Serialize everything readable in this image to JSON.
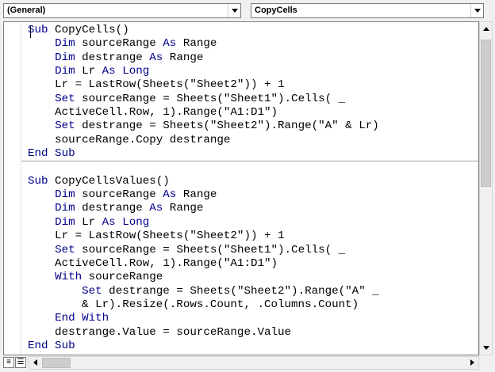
{
  "object_combo": {
    "value": "(General)"
  },
  "procedure_combo": {
    "value": "CopyCells"
  },
  "code": {
    "lines": [
      [
        [
          "kw",
          "Sub"
        ],
        [
          "t",
          " CopyCells()"
        ]
      ],
      [
        [
          "t",
          "    "
        ],
        [
          "kw",
          "Dim"
        ],
        [
          "t",
          " sourceRange "
        ],
        [
          "kw",
          "As"
        ],
        [
          "t",
          " Range"
        ]
      ],
      [
        [
          "t",
          "    "
        ],
        [
          "kw",
          "Dim"
        ],
        [
          "t",
          " destrange "
        ],
        [
          "kw",
          "As"
        ],
        [
          "t",
          " Range"
        ]
      ],
      [
        [
          "t",
          "    "
        ],
        [
          "kw",
          "Dim"
        ],
        [
          "t",
          " Lr "
        ],
        [
          "kw",
          "As Long"
        ]
      ],
      [
        [
          "t",
          "    Lr = LastRow(Sheets(\"Sheet2\")) + 1"
        ]
      ],
      [
        [
          "t",
          "    "
        ],
        [
          "kw",
          "Set"
        ],
        [
          "t",
          " sourceRange = Sheets(\"Sheet1\").Cells( _"
        ]
      ],
      [
        [
          "t",
          "    ActiveCell.Row, 1).Range(\"A1:D1\")"
        ]
      ],
      [
        [
          "t",
          "    "
        ],
        [
          "kw",
          "Set"
        ],
        [
          "t",
          " destrange = Sheets(\"Sheet2\").Range(\"A\" & Lr)"
        ]
      ],
      [
        [
          "t",
          "    sourceRange.Copy destrange"
        ]
      ],
      [
        [
          "kw",
          "End Sub"
        ]
      ],
      [
        [
          "t",
          ""
        ]
      ],
      [
        [
          "kw",
          "Sub"
        ],
        [
          "t",
          " CopyCellsValues()"
        ]
      ],
      [
        [
          "t",
          "    "
        ],
        [
          "kw",
          "Dim"
        ],
        [
          "t",
          " sourceRange "
        ],
        [
          "kw",
          "As"
        ],
        [
          "t",
          " Range"
        ]
      ],
      [
        [
          "t",
          "    "
        ],
        [
          "kw",
          "Dim"
        ],
        [
          "t",
          " destrange "
        ],
        [
          "kw",
          "As"
        ],
        [
          "t",
          " Range"
        ]
      ],
      [
        [
          "t",
          "    "
        ],
        [
          "kw",
          "Dim"
        ],
        [
          "t",
          " Lr "
        ],
        [
          "kw",
          "As Long"
        ]
      ],
      [
        [
          "t",
          "    Lr = LastRow(Sheets(\"Sheet2\")) + 1"
        ]
      ],
      [
        [
          "t",
          "    "
        ],
        [
          "kw",
          "Set"
        ],
        [
          "t",
          " sourceRange = Sheets(\"Sheet1\").Cells( _"
        ]
      ],
      [
        [
          "t",
          "    ActiveCell.Row, 1).Range(\"A1:D1\")"
        ]
      ],
      [
        [
          "t",
          "    "
        ],
        [
          "kw",
          "With"
        ],
        [
          "t",
          " sourceRange"
        ]
      ],
      [
        [
          "t",
          "        "
        ],
        [
          "kw",
          "Set"
        ],
        [
          "t",
          " destrange = Sheets(\"Sheet2\").Range(\"A\" _"
        ]
      ],
      [
        [
          "t",
          "        & Lr).Resize(.Rows.Count, .Columns.Count)"
        ]
      ],
      [
        [
          "t",
          "    "
        ],
        [
          "kw",
          "End With"
        ]
      ],
      [
        [
          "t",
          "    destrange.Value = sourceRange.Value"
        ]
      ],
      [
        [
          "kw",
          "End Sub"
        ]
      ]
    ]
  },
  "view_buttons": {
    "procedure_view_icon": "procedure-view-icon",
    "module_view_icon": "full-module-view-icon"
  }
}
